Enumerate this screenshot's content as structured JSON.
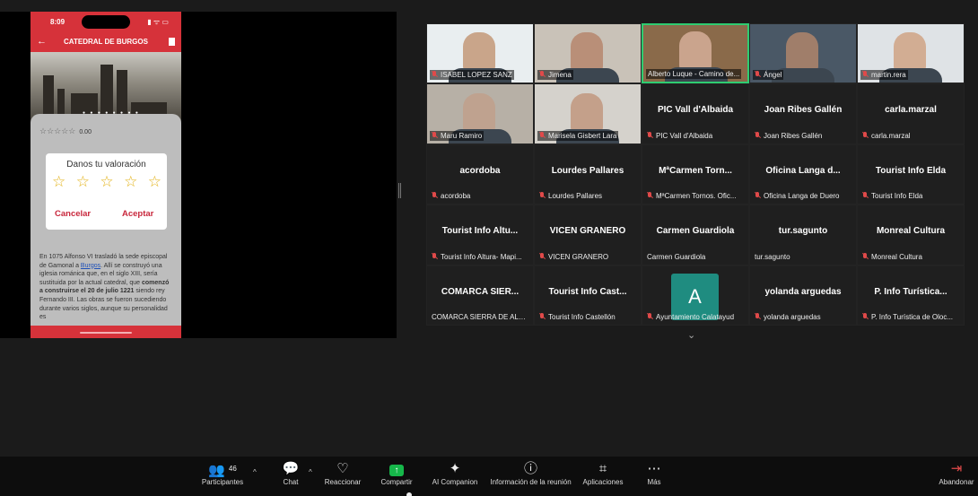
{
  "phone": {
    "time": "8:09",
    "title": "CATEDRAL DE BURGOS",
    "rating_value": "0.00",
    "dialog_title": "Danos tu valoración",
    "cancel": "Cancelar",
    "accept": "Aceptar",
    "text_a": "En 1075 Alfonso VI trasladó la sede episcopal de Gamonal a ",
    "text_link": "Burgos",
    "text_b": ". Allí se construyó una iglesia románica que, en el siglo XIII, sería sustituida por la actual catedral, que ",
    "text_bold": "comenzó a construirse el 20 de julio 1221",
    "text_c": " siendo rey Fernando III. Las obras se fueron sucediendo durante varios siglos, aunque su personalidad es"
  },
  "gallery": {
    "tiles": [
      {
        "name": "",
        "label": "ISABEL LOPEZ SANZ",
        "muted": true,
        "video": true
      },
      {
        "name": "",
        "label": "Jimena",
        "muted": true,
        "video": true
      },
      {
        "name": "",
        "label": "Alberto Luque - Camino de...",
        "muted": false,
        "video": true,
        "active": true
      },
      {
        "name": "",
        "label": "Ángel",
        "muted": true,
        "video": true
      },
      {
        "name": "",
        "label": "martin.rera",
        "muted": true,
        "video": true
      },
      {
        "name": "",
        "label": "Maru Ramiro",
        "muted": true,
        "video": true
      },
      {
        "name": "",
        "label": "Marisela Gisbert Lara",
        "muted": true,
        "video": true
      },
      {
        "name": "PIC Vall d'Albaida",
        "label": "PIC Vall d'Albaida",
        "muted": true
      },
      {
        "name": "Joan Ribes Gallén",
        "label": "Joan Ribes Gallén",
        "muted": true
      },
      {
        "name": "carla.marzal",
        "label": "carla.marzal",
        "muted": true
      },
      {
        "name": "acordoba",
        "label": "acordoba",
        "muted": true
      },
      {
        "name": "Lourdes Pallares",
        "label": "Lourdes Pallares",
        "muted": true
      },
      {
        "name": "MªCarmen Torn...",
        "label": "MªCarmen Tornos. Ofic...",
        "muted": true
      },
      {
        "name": "Oficina Langa d...",
        "label": "Oficina Langa de Duero",
        "muted": true
      },
      {
        "name": "Tourist Info Elda",
        "label": "Tourist Info Elda",
        "muted": true
      },
      {
        "name": "Tourist Info Altu...",
        "label": "Tourist Info Altura- Mapi...",
        "muted": true
      },
      {
        "name": "VICEN GRANERO",
        "label": "VICEN GRANERO",
        "muted": true
      },
      {
        "name": "Carmen Guardiola",
        "label": "Carmen Guardiola",
        "muted": false
      },
      {
        "name": "tur.sagunto",
        "label": "tur.sagunto",
        "muted": false
      },
      {
        "name": "Monreal Cultura",
        "label": "Monreal Cultura",
        "muted": true
      },
      {
        "name": "COMARCA SIER...",
        "label": "COMARCA SIERRA DE ALBA...",
        "muted": false
      },
      {
        "name": "Tourist Info Cast...",
        "label": "Tourist Info Castellón",
        "muted": true
      },
      {
        "name": "",
        "avatar": "A",
        "label": "Ayuntamiento Calatayud",
        "muted": true
      },
      {
        "name": "yolanda arguedas",
        "label": "yolanda arguedas",
        "muted": true
      },
      {
        "name": "P. Info Turística...",
        "label": "P. Info Turística de Oloc...",
        "muted": true
      }
    ]
  },
  "toolbar": {
    "participants_count": "46",
    "participants": "Participantes",
    "chat": "Chat",
    "react": "Reaccionar",
    "share": "Compartir",
    "companion": "AI Companion",
    "info": "Información de la reunión",
    "apps": "Aplicaciones",
    "more": "Más",
    "leave": "Abandonar"
  },
  "colors": {
    "accent_green": "#16b74a",
    "active_border": "#2ecc71",
    "leave_red": "#e04a4a",
    "app_red": "#d6323a"
  }
}
